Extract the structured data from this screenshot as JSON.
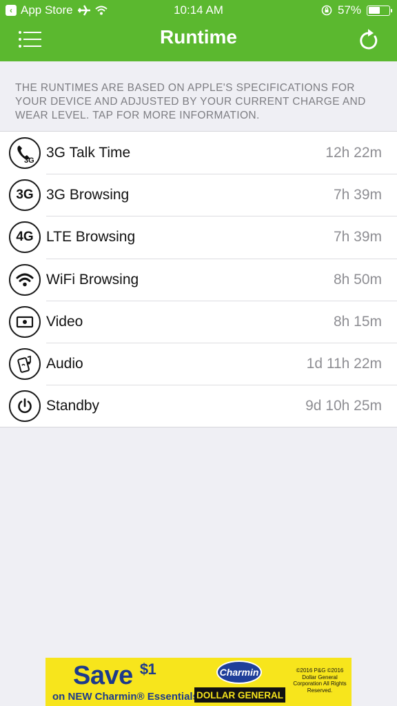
{
  "status_bar": {
    "back_app": "App Store",
    "time": "10:14 AM",
    "battery_percent": "57%",
    "battery_level": 0.57,
    "icons": [
      "airplane-icon",
      "wifi-icon",
      "rotation-lock-icon",
      "battery-icon"
    ]
  },
  "nav": {
    "title": "Runtime",
    "menu_icon": "list-menu-icon",
    "refresh_icon": "refresh-icon"
  },
  "info_text": "THE RUNTIMES ARE BASED ON APPLE'S SPECIFICATIONS FOR YOUR DEVICE AND ADJUSTED BY YOUR CURRENT CHARGE AND WEAR LEVEL. TAP FOR MORE INFORMATION.",
  "rows": [
    {
      "icon": "phone-3g-icon",
      "icon_text": "3G",
      "label": "3G Talk Time",
      "value": "12h 22m"
    },
    {
      "icon": "3g-icon",
      "icon_text": "3G",
      "label": "3G Browsing",
      "value": "7h 39m"
    },
    {
      "icon": "4g-icon",
      "icon_text": "4G",
      "label": "LTE Browsing",
      "value": "7h 39m"
    },
    {
      "icon": "wifi-icon",
      "icon_text": "",
      "label": "WiFi Browsing",
      "value": "8h 50m"
    },
    {
      "icon": "video-icon",
      "icon_text": "",
      "label": "Video",
      "value": "8h 15m"
    },
    {
      "icon": "audio-icon",
      "icon_text": "",
      "label": "Audio",
      "value": "1d 11h 22m"
    },
    {
      "icon": "power-icon",
      "icon_text": "",
      "label": "Standby",
      "value": "9d 10h 25m"
    }
  ],
  "ad": {
    "headline": "Save",
    "amount": "$1",
    "subline": "on NEW Charmin® Essentials",
    "brand": "Charmin",
    "retailer": "DOLLAR GENERAL",
    "legal": "©2016 P&G ©2016 Dollar General Corporation All Rights Reserved."
  },
  "colors": {
    "header_green": "#5bb82f",
    "background": "#efeff4",
    "ad_yellow": "#f7e51c"
  }
}
